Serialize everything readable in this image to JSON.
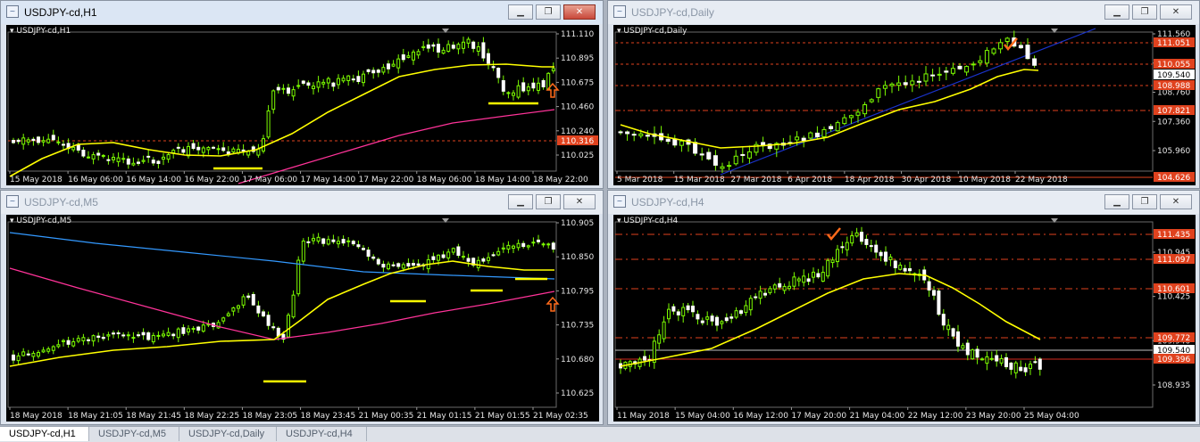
{
  "windows": [
    {
      "id": "h1",
      "title": "USDJPY-cd,H1",
      "chart_label": "USDJPY-cd,H1",
      "active": true,
      "price_labels": [
        "111.110",
        "110.895",
        "110.675",
        "110.460",
        "110.240",
        "110.025"
      ],
      "time_labels": [
        "15 May 2018",
        "16 May 06:00",
        "16 May 14:00",
        "16 May 22:00",
        "17 May 06:00",
        "17 May 14:00",
        "17 May 22:00",
        "18 May 06:00",
        "18 May 14:00",
        "18 May 22:00"
      ],
      "tags": [
        {
          "text": "110.316",
          "color": "#e0421e"
        }
      ]
    },
    {
      "id": "daily",
      "title": "USDJPY-cd,Daily",
      "chart_label": "USDJPY-cd,Daily",
      "active": false,
      "price_labels": [
        "111.560",
        "110.160",
        "108.760",
        "107.360",
        "105.960"
      ],
      "time_labels": [
        "5 Mar 2018",
        "15 Mar 2018",
        "27 Mar 2018",
        "6 Apr 2018",
        "18 Apr 2018",
        "30 Apr 2018",
        "10 May 2018",
        "22 May 2018"
      ],
      "tags": [
        {
          "text": "111.051",
          "color": "#e0421e"
        },
        {
          "text": "110.055",
          "color": "#e0421e"
        },
        {
          "text": "109.540",
          "color": "#ffffff"
        },
        {
          "text": "108.988",
          "color": "#e0421e"
        },
        {
          "text": "107.821",
          "color": "#e0421e"
        },
        {
          "text": "104.626",
          "color": "#e0421e"
        }
      ]
    },
    {
      "id": "m5",
      "title": "USDJPY-cd,M5",
      "chart_label": "USDJPY-cd,M5",
      "active": false,
      "price_labels": [
        "110.905",
        "110.850",
        "110.795",
        "110.735",
        "110.680",
        "110.625"
      ],
      "time_labels": [
        "18 May 2018",
        "18 May 21:05",
        "18 May 21:45",
        "18 May 22:25",
        "18 May 23:05",
        "18 May 23:45",
        "21 May 00:35",
        "21 May 01:15",
        "21 May 01:55",
        "21 May 02:35"
      ],
      "tags": []
    },
    {
      "id": "h4",
      "title": "USDJPY-cd,H4",
      "chart_label": "USDJPY-cd,H4",
      "active": false,
      "price_labels": [
        "110.945",
        "110.425",
        "109.940",
        "108.935"
      ],
      "time_labels": [
        "11 May 2018",
        "15 May 04:00",
        "16 May 12:00",
        "17 May 20:00",
        "21 May 04:00",
        "22 May 12:00",
        "23 May 20:00",
        "25 May 04:00"
      ],
      "tags": [
        {
          "text": "111.435",
          "color": "#e0421e"
        },
        {
          "text": "111.097",
          "color": "#e0421e"
        },
        {
          "text": "110.601",
          "color": "#e0421e"
        },
        {
          "text": "109.772",
          "color": "#e0421e"
        },
        {
          "text": "109.540",
          "color": "#ffffff"
        },
        {
          "text": "109.396",
          "color": "#e0421e"
        }
      ]
    }
  ],
  "tabs": [
    {
      "label": "USDJPY-cd,H1",
      "active": true
    },
    {
      "label": "USDJPY-cd,M5",
      "active": false
    },
    {
      "label": "USDJPY-cd,Daily",
      "active": false
    },
    {
      "label": "USDJPY-cd,H4",
      "active": false
    }
  ],
  "icons": {
    "window": "chart-window-icon",
    "minimize": "minimize-icon",
    "restore": "restore-icon",
    "close": "close-icon"
  },
  "colors": {
    "bull": "#7cfc00",
    "bear": "#ffffff",
    "ma_fast": "#ffff00",
    "ma_slow": "#ff3399",
    "ma_long": "#3399ff",
    "level": "#e0421e",
    "trend": "#1a33cc"
  }
}
